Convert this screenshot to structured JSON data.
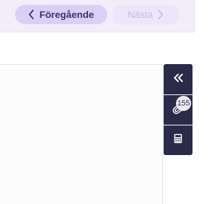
{
  "nav": {
    "prev_label": "Föregående",
    "next_label": "Nästa"
  },
  "toolbox": {
    "collapse_icon": "double-chevron-left-icon",
    "attachment_icon": "paperclip-icon",
    "attachment_count": "155",
    "calculator_icon": "calculator-icon"
  },
  "colors": {
    "topbar_bg": "#f1eefa",
    "prev_button_bg": "#d9d1f5",
    "next_button_bg": "#ebe6f9",
    "toolbox_bg": "#2b2a48"
  }
}
